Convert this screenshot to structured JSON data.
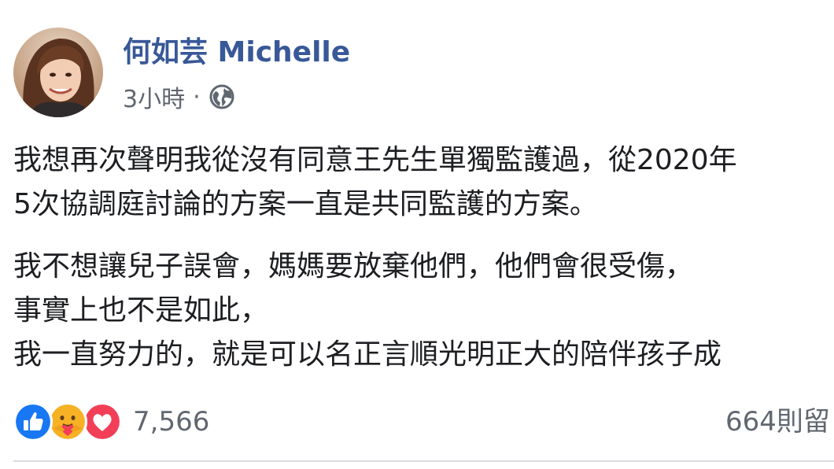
{
  "post": {
    "author_name": "何如芸 Michelle",
    "timestamp": "3小時",
    "separator": "·",
    "privacy_icon": "globe-icon",
    "body_lines": [
      "我想再次聲明我從沒有同意王先生單獨監護過，從2020年",
      "5次協調庭討論的方案一直是共同監護的方案。",
      "我不想讓兒子誤會，媽媽要放棄他們，他們會很受傷，",
      "事實上也不是如此，",
      "我一直努力的，就是可以名正言順光明正大的陪伴孩子成"
    ]
  },
  "footer": {
    "reaction_icons": [
      "like-icon",
      "care-icon",
      "love-icon"
    ],
    "reaction_count": "7,566",
    "comment_count": "664則留"
  },
  "colors": {
    "author": "#385898",
    "meta": "#606770",
    "text": "#1c1e21",
    "like": "#1877f2",
    "love": "#f33e58",
    "care": "#f7b125"
  }
}
